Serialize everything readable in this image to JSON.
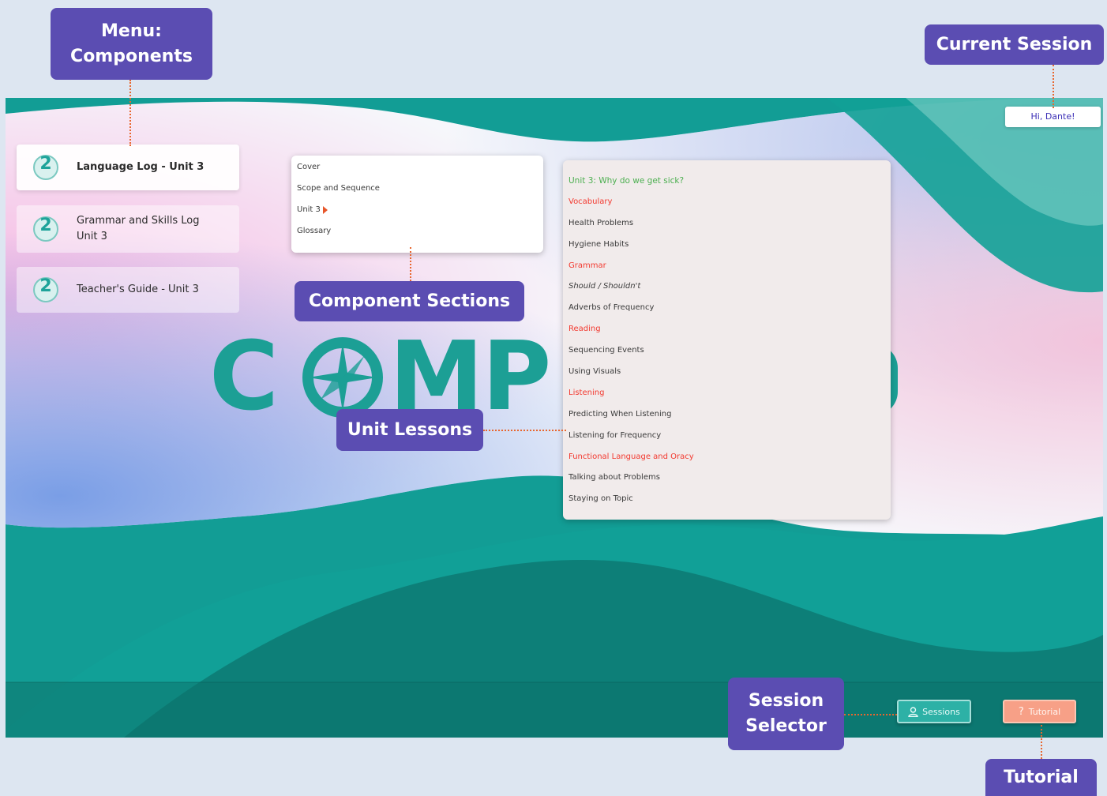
{
  "callouts": {
    "menu": "Menu:\nComponents",
    "current_session": "Current Session",
    "component_sections": "Component Sections",
    "unit_lessons": "Unit Lessons",
    "session_selector": "Session\nSelector",
    "tutorial": "Tutorial"
  },
  "app": {
    "logo_text": "COMP",
    "greeting": "Hi, Dante!",
    "components": [
      {
        "badge": "2",
        "label": "Language Log - Unit 3",
        "active": true
      },
      {
        "badge": "2",
        "label": "Grammar and Skills Log\nUnit 3",
        "active": false
      },
      {
        "badge": "2",
        "label": "Teacher's Guide - Unit 3",
        "active": false
      }
    ],
    "sections": [
      "Cover",
      "Scope and Sequence",
      "Unit 3",
      "Glossary"
    ],
    "lessons": [
      {
        "text": "Unit 3: Why do we get sick?",
        "kind": "unit"
      },
      {
        "text": "Vocabulary",
        "kind": "cat"
      },
      {
        "text": "Health Problems",
        "kind": "item"
      },
      {
        "text": "Hygiene Habits",
        "kind": "item"
      },
      {
        "text": "Grammar",
        "kind": "cat"
      },
      {
        "text": "Should / Shouldn't",
        "kind": "it"
      },
      {
        "text": "Adverbs of Frequency",
        "kind": "item"
      },
      {
        "text": "Reading",
        "kind": "cat"
      },
      {
        "text": "Sequencing Events",
        "kind": "item"
      },
      {
        "text": "Using Visuals",
        "kind": "item"
      },
      {
        "text": "Listening",
        "kind": "cat"
      },
      {
        "text": "Predicting When Listening",
        "kind": "item"
      },
      {
        "text": "Listening for Frequency",
        "kind": "item"
      },
      {
        "text": "Functional Language and Oracy",
        "kind": "cat"
      },
      {
        "text": "Talking about Problems",
        "kind": "item"
      },
      {
        "text": "Staying on Topic",
        "kind": "item"
      }
    ],
    "buttons": {
      "sessions": "Sessions",
      "tutorial": "Tutorial",
      "tutorial_glyph": "?"
    }
  },
  "colors": {
    "teal": "#129d95",
    "callout": "#5b4db2",
    "category_red": "#f2392f",
    "unit_green": "#4caf50",
    "greeting_blue": "#3b2fb6"
  }
}
